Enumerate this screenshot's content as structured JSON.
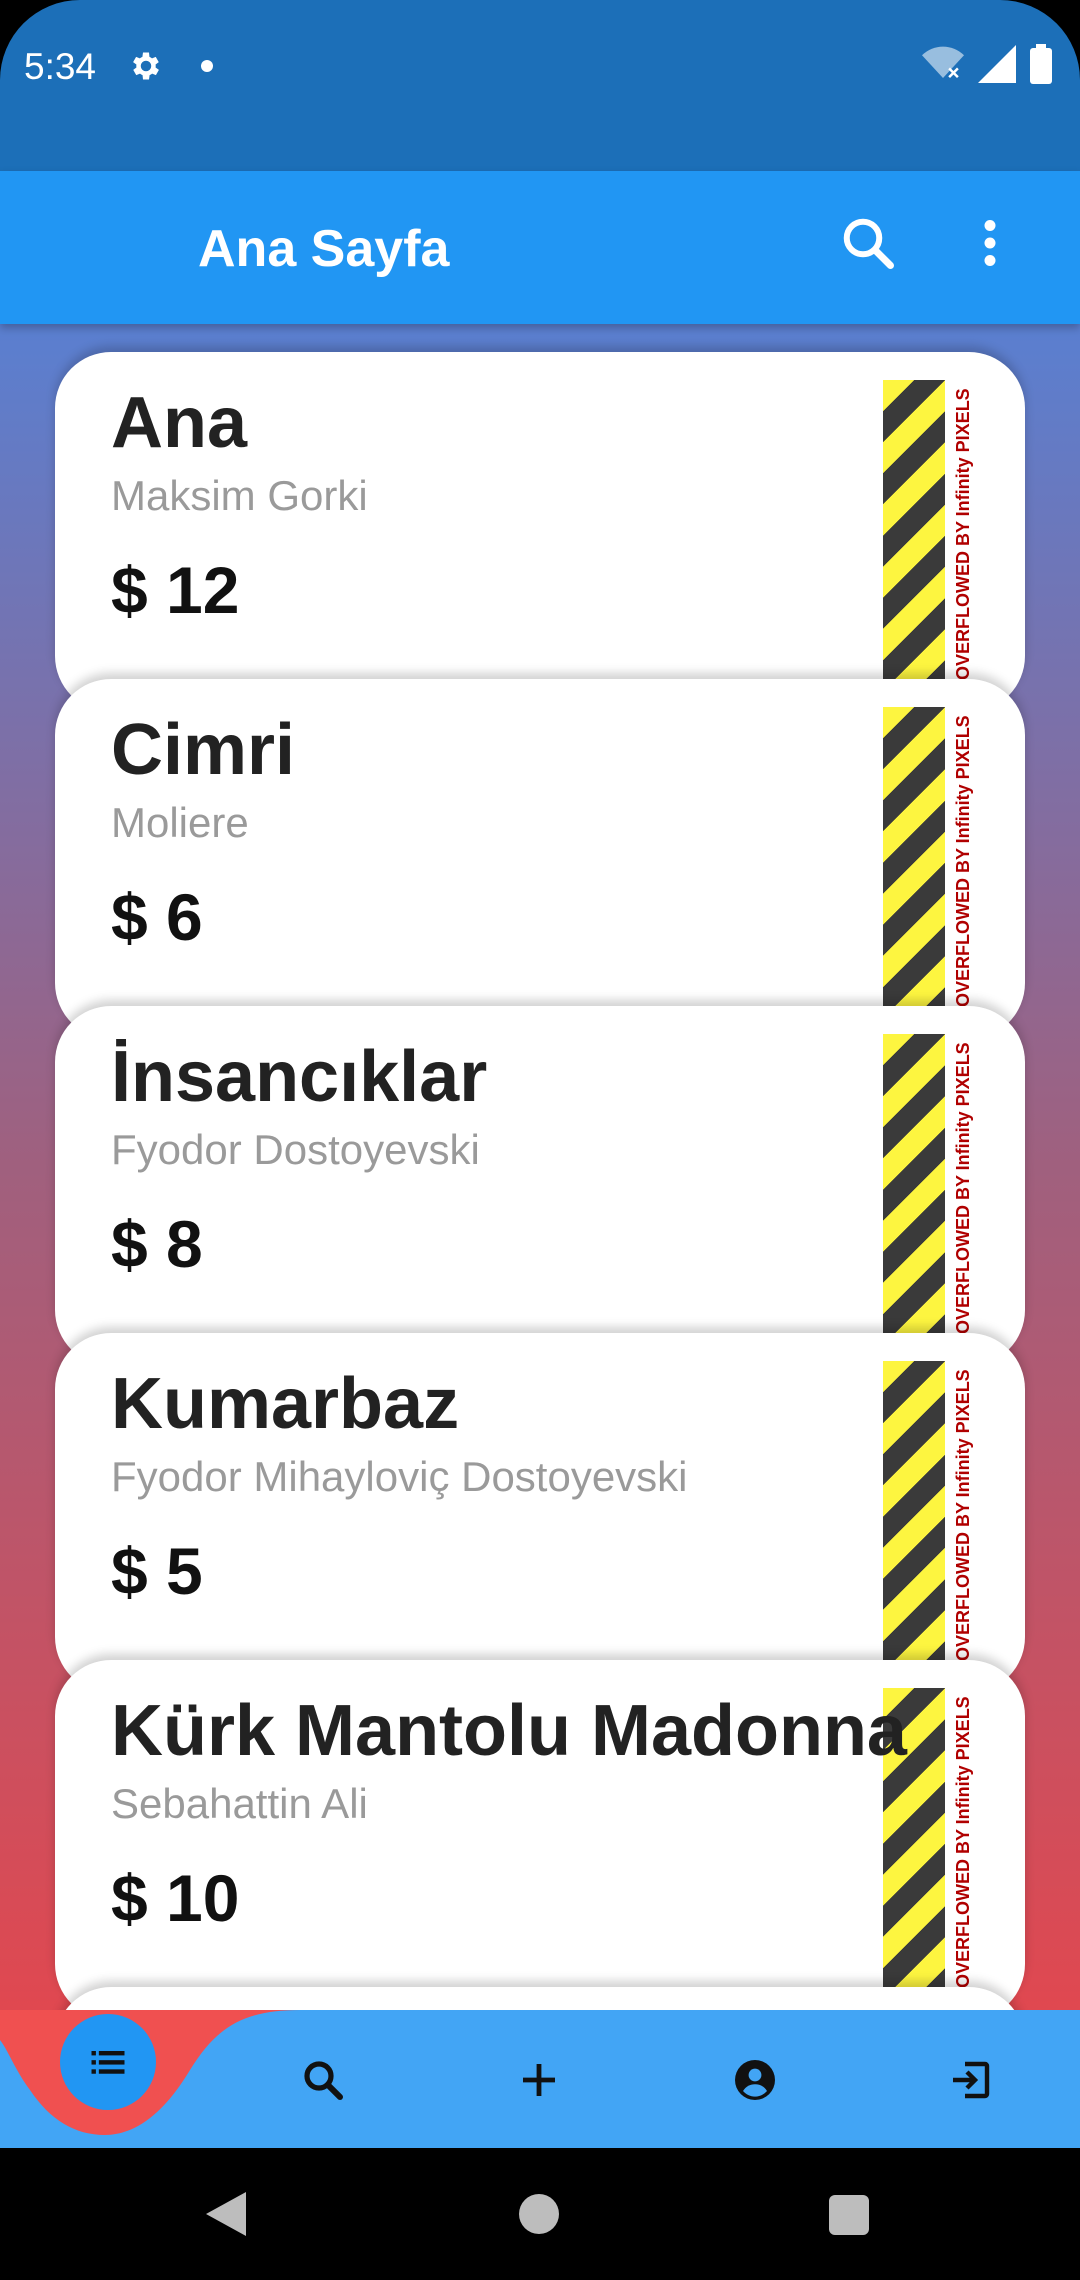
{
  "status_bar": {
    "time": "5:34"
  },
  "app_bar": {
    "title": "Ana Sayfa"
  },
  "books": [
    {
      "title": "Ana",
      "author": "Maksim Gorki",
      "price": "$ 12"
    },
    {
      "title": "Cimri",
      "author": "Moliere",
      "price": "$ 6"
    },
    {
      "title": "İnsancıklar",
      "author": "Fyodor Dostoyevski",
      "price": "$ 8"
    },
    {
      "title": "Kumarbaz",
      "author": "Fyodor Mihayloviç Dostoyevski",
      "price": "$ 5"
    },
    {
      "title": "Kürk Mantolu Madonna",
      "author": "Sebahattin Ali",
      "price": "$ 10"
    }
  ],
  "overflow_warning": "OVERFLOWED BY Infinity PIXELS",
  "bottom_nav": {
    "items": [
      "list-icon",
      "search-icon",
      "add-icon",
      "account-icon",
      "logout-icon"
    ],
    "active": "list-icon"
  },
  "colors": {
    "status_bar": "#1c6fb8",
    "app_bar": "#2196f3",
    "bottom_nav": "#42a5f5",
    "nav_active_bump": "#f05050"
  }
}
